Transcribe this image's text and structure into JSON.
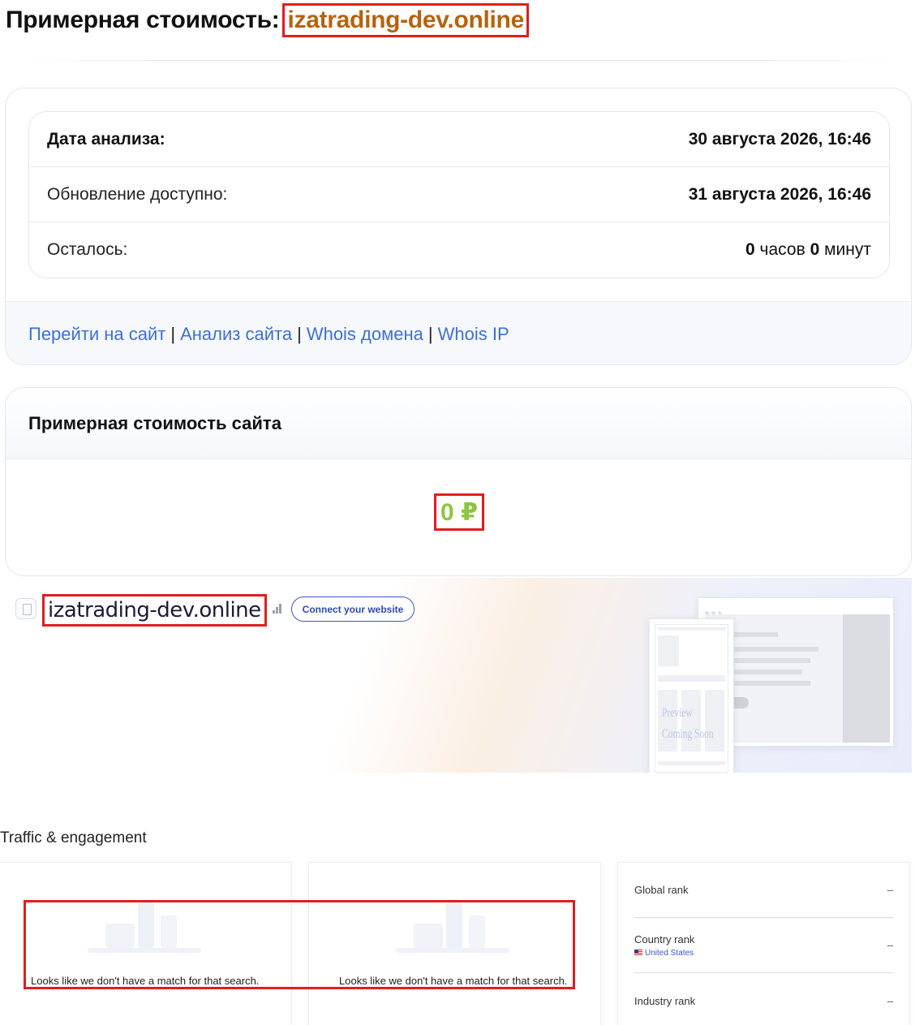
{
  "header": {
    "title_prefix": "Примерная стоимость:",
    "domain": "izatrading-dev.online"
  },
  "info": {
    "rows": [
      {
        "label": "Дата анализа:",
        "value": "30 августа 2026, 16:46"
      },
      {
        "label": "Обновление доступно:",
        "value": "31 августа 2026, 16:46"
      }
    ],
    "remaining": {
      "label": "Осталось:",
      "hours": "0",
      "hours_unit": "часов",
      "minutes": "0",
      "minutes_unit": "минут"
    }
  },
  "links": {
    "visit": "Перейти на сайт",
    "analysis": "Анализ сайта",
    "whois_domain": "Whois домена",
    "whois_ip": "Whois IP",
    "separator": "|"
  },
  "value_card": {
    "title": "Примерная стоимость сайта",
    "price": "0 ₽"
  },
  "similarweb": {
    "domain": "izatrading-dev.online",
    "connect_label": "Connect your website",
    "preview_text_1": "Preview",
    "preview_text_2": "Coming Soon"
  },
  "traffic": {
    "title": "Traffic & engagement",
    "no_match": "Looks like we don't have a match for that search.",
    "ranks": [
      {
        "label": "Global rank",
        "sub": "",
        "value": "–"
      },
      {
        "label": "Country rank",
        "sub": "United States",
        "value": "–"
      },
      {
        "label": "Industry rank",
        "sub": "",
        "value": "–"
      }
    ]
  },
  "colors": {
    "accent_domain": "#b8620c",
    "link": "#3d6fd9",
    "price": "#8dc63f",
    "highlight": "#e01e1e"
  }
}
